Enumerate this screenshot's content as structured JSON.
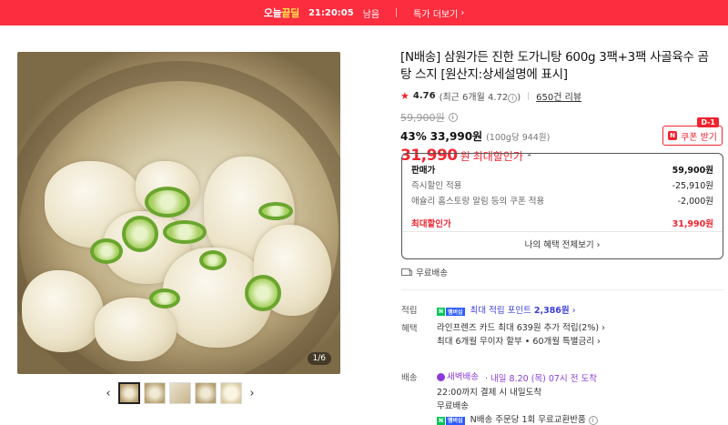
{
  "topbar": {
    "badge_prefix": "오늘",
    "badge_highlight": "끝딜",
    "time": "21:20:05",
    "time_suffix": "남음",
    "deals_link": "특가 더보기",
    "color": "#fb2d3e"
  },
  "gallery": {
    "counter": "1/6",
    "prev_icon": "chevron-left-icon",
    "next_icon": "chevron-right-icon",
    "thumbnail_count": 5,
    "active_index": 0
  },
  "product": {
    "title": "[N배송] 삼원가든 진한 도가니탕 600g 3팩+3팩 사골육수 곰탕 스지 [원산지:상세설명에 표시]",
    "rating": "4.76",
    "rating_recent": "(최근 6개월 4.72",
    "rating_recent_close": ")",
    "reviews": "650건 리뷰",
    "original_price": "59,900원",
    "discount_rate": "43%",
    "discount_price": "33,990원",
    "unit_price": "(100g당 944원)",
    "best_price": "31,990",
    "best_price_won": "원",
    "best_price_label": "최대할인가",
    "accent": "#f0242f"
  },
  "coupon": {
    "dday": "D-1",
    "label": "쿠폰 받기"
  },
  "price_box": {
    "rows": [
      {
        "label": "판매가",
        "value": "59,900원"
      },
      {
        "label": "즉시할인 적용",
        "value": "-25,910원"
      },
      {
        "label": "애슐리 홈스토랑 알림 등의 쿠폰 적용",
        "value": "-2,000원"
      }
    ],
    "final_label": "최대할인가",
    "final_value": "31,990원",
    "more_link": "나의 혜택 전체보기"
  },
  "shipping": {
    "label": "무료배송"
  },
  "benefits": {
    "points_label": "적립",
    "points_badge": "멤버십",
    "points_text": "최대 적립 포인트",
    "points_value": "2,386원",
    "benefit_label": "혜택",
    "benefit_line1": "라인프렌즈 카드 최대 639원 추가 적립(2%)",
    "benefit_line2": "최대 6개월 무이자 할부 • 60개월 특별금리",
    "delivery_label": "배송",
    "dawn_badge": "새벽배송",
    "delivery_eta": "내일 8.20 (목) 07시 전 도착",
    "delivery_line2": "22:00까지 결제 시 내일도착",
    "delivery_line3": "무료배송",
    "delivery_line4": "N배송 주문당 1회 무료교환반품"
  }
}
